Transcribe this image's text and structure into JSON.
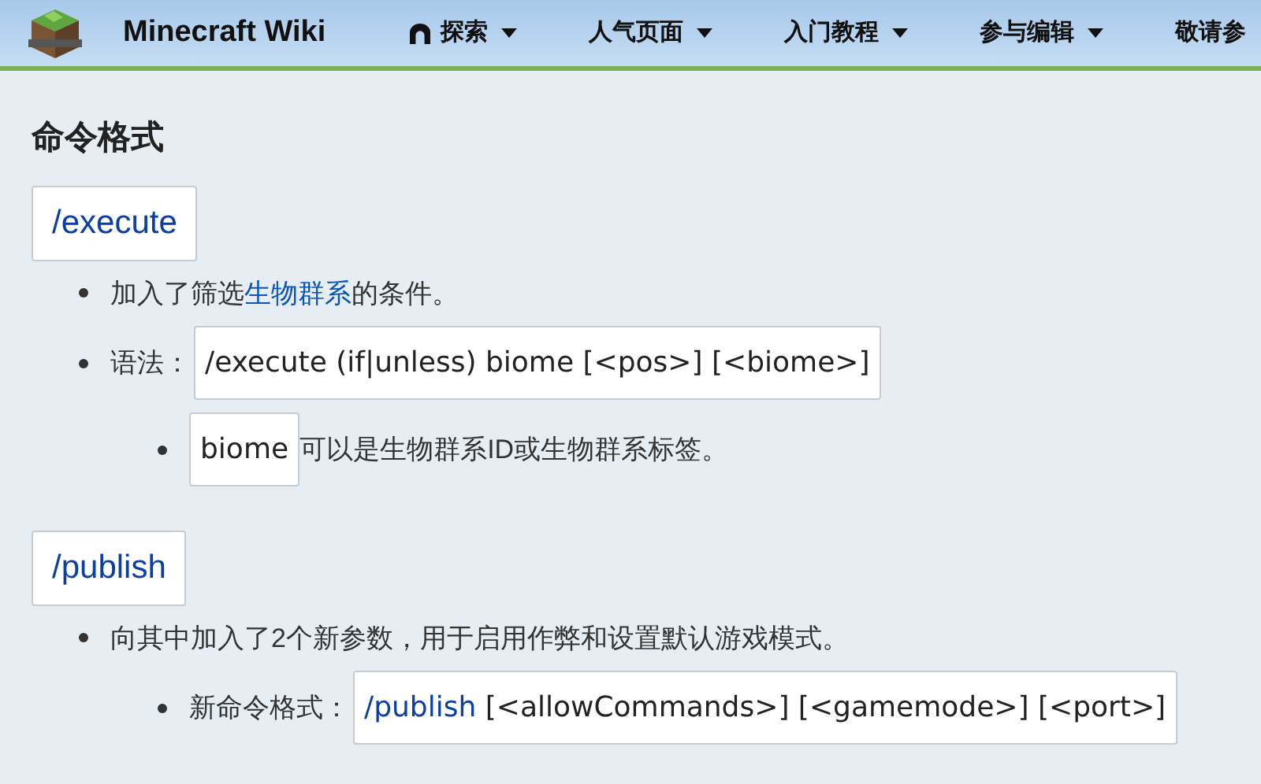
{
  "header": {
    "site_title": "Minecraft Wiki",
    "nav": [
      {
        "label": "探索",
        "kind": "explore"
      },
      {
        "label": "人气页面",
        "kind": "dropdown"
      },
      {
        "label": "入门教程",
        "kind": "dropdown"
      },
      {
        "label": "参与编辑",
        "kind": "dropdown"
      },
      {
        "label": "敬请参",
        "kind": "plain"
      }
    ]
  },
  "content": {
    "heading": "命令格式",
    "sections": [
      {
        "command": "/execute",
        "items": [
          {
            "parts": [
              {
                "kind": "text",
                "text": "加入了筛选"
              },
              {
                "kind": "link",
                "text": "生物群系"
              },
              {
                "kind": "text",
                "text": "的条件。"
              }
            ]
          },
          {
            "parts": [
              {
                "kind": "text",
                "text": "语法："
              },
              {
                "kind": "code",
                "segments": [
                  {
                    "text": "/execute (if|unless) biome [<pos>] [<biome>]",
                    "link": false
                  }
                ]
              }
            ],
            "children": [
              {
                "parts": [
                  {
                    "kind": "code",
                    "segments": [
                      {
                        "text": "biome",
                        "link": false
                      }
                    ]
                  },
                  {
                    "kind": "text",
                    "text": "可以是生物群系ID或生物群系标签。"
                  }
                ]
              }
            ]
          }
        ]
      },
      {
        "command": "/publish",
        "items": [
          {
            "parts": [
              {
                "kind": "text",
                "text": "向其中加入了2个新参数，用于启用作弊和设置默认游戏模式。"
              }
            ],
            "children": [
              {
                "parts": [
                  {
                    "kind": "text",
                    "text": "新命令格式："
                  },
                  {
                    "kind": "code",
                    "segments": [
                      {
                        "text": "/publish",
                        "link": true
                      },
                      {
                        "text": " [<allowCommands>] [<gamemode>] [<port>]",
                        "link": false
                      }
                    ]
                  }
                ]
              }
            ]
          }
        ]
      }
    ]
  }
}
